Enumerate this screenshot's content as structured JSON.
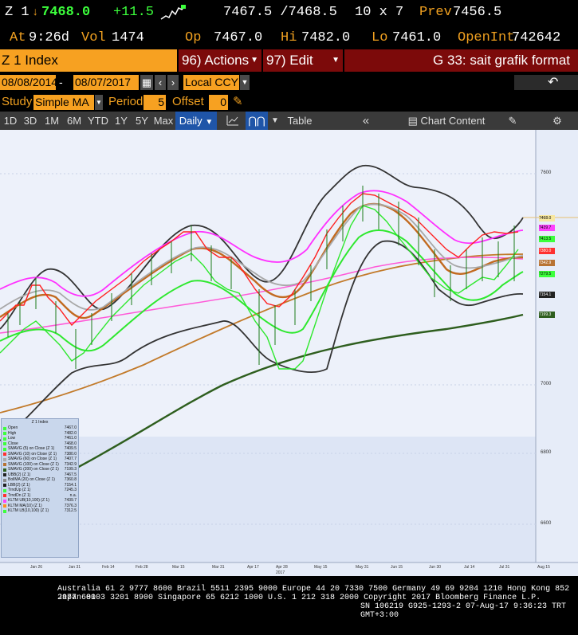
{
  "header": {
    "ticker": "Z 1",
    "last": "7468.0",
    "change": "+11.5",
    "bid_ask": "7467.5 /7468.5",
    "size": "10 x 7",
    "prev_label": "Prev",
    "prev": "7456.5",
    "at_label": "At",
    "time": "9:26d",
    "vol_label": "Vol",
    "vol": "1474",
    "op_label": "Op",
    "op": "7467.0",
    "hi_label": "Hi",
    "hi": "7482.0",
    "lo_label": "Lo",
    "lo": "7461.0",
    "oi_label": "OpenInt",
    "oi": "742642"
  },
  "commandbar": {
    "security": "Z 1 Index",
    "actions": "96) Actions",
    "edit": "97) Edit",
    "function": "G 33: sait grafik format"
  },
  "range": {
    "start": "08/08/2014",
    "dash": "-",
    "end": "08/07/2017",
    "currency": "Local CCY"
  },
  "study": {
    "label": "Study",
    "type": "Simple MA",
    "period_label": "Period",
    "period": "5",
    "offset_label": "Offset",
    "offset": "0"
  },
  "toolbar": {
    "periods": [
      "1D",
      "3D",
      "1M",
      "6M",
      "YTD",
      "1Y",
      "5Y",
      "Max"
    ],
    "frequency": "Daily",
    "table": "Table",
    "chart_content": "Chart Content"
  },
  "chart": {
    "yaxis": [
      "7600",
      "7000",
      "6800",
      "6600"
    ],
    "xaxis": [
      "Jan 26",
      "Jan 31",
      "Feb 14",
      "Feb 28",
      "Mar 15",
      "Mar 31",
      "Apr 17",
      "Apr 28",
      "May 15",
      "May 31",
      "Jun 15",
      "Jun 30",
      "Jul 14",
      "Jul 31",
      "Aug 15"
    ],
    "year": "2017",
    "right_tags": [
      {
        "v": "7468.0",
        "c": "#f7e7a0"
      },
      {
        "v": "7439.7",
        "c": "#ff40ff"
      },
      {
        "v": "7413.5",
        "c": "#3cff3c"
      },
      {
        "v": "7380.0",
        "c": "#ff3030"
      },
      {
        "v": "7342.9",
        "c": "#b87333"
      },
      {
        "v": "7279.5",
        "c": "#3cff3c"
      },
      {
        "v": "7154.1",
        "c": "#222222"
      },
      {
        "v": "7199.3",
        "c": "#2e5e1e"
      }
    ]
  },
  "legend": {
    "title": "Z 1 Index",
    "items": [
      {
        "label": "Open",
        "value": "7467.0",
        "color": "#3cff3c"
      },
      {
        "label": "High",
        "value": "7482.0",
        "color": "#3cff3c"
      },
      {
        "label": "Low",
        "value": "7461.0",
        "color": "#3cff3c"
      },
      {
        "label": "Close",
        "value": "7468.0",
        "color": "#3cff3c"
      },
      {
        "label": "SMAVG (5) on Close (Z 1)",
        "value": "7409.5",
        "color": "#3cff3c"
      },
      {
        "label": "SMAVG (10) on Close (Z 1)",
        "value": "7380.0",
        "color": "#ff3030"
      },
      {
        "label": "SMAVG (60) on Close (Z 1)",
        "value": "7407.7",
        "color": "#aaaaaa"
      },
      {
        "label": "SMAVG (100) on Close (Z 1)",
        "value": "7342.9",
        "color": "#b87333"
      },
      {
        "label": "SMAVG (200) on Close (Z 1)",
        "value": "7199.3",
        "color": "#2e5e1e"
      },
      {
        "label": "UBB(2) (Z 1)",
        "value": "7467.5",
        "color": "#222222"
      },
      {
        "label": "BollMA (20) on Close (Z 1)",
        "value": "7360.8",
        "color": "#888888"
      },
      {
        "label": "LBB(2) (Z 1)",
        "value": "7154.1",
        "color": "#222222"
      },
      {
        "label": "TrndUp (Z 1)",
        "value": "7245.3",
        "color": "#3cff3c"
      },
      {
        "label": "TrndDn (Z 1)",
        "value": "n.a.",
        "color": "#ff3030"
      },
      {
        "label": "KLTM UB(10,100) (Z 1)",
        "value": "7439.7",
        "color": "#ff40ff"
      },
      {
        "label": "KLTM MA(10) (Z 1)",
        "value": "7376.3",
        "color": "#ff9020"
      },
      {
        "label": "KLTM LB(10,100) (Z 1)",
        "value": "7312.5",
        "color": "#3cff3c"
      }
    ]
  },
  "footer": {
    "line1": "Australia 61 2 9777 8600 Brazil 5511 2395 9000 Europe 44 20 7330 7500 Germany 49 69 9204 1210 Hong Kong 852 2977 6000",
    "line2": "Japan 81 3 3201 8900        Singapore 65 6212 1000        U.S. 1 212 318 2000         Copyright 2017 Bloomberg Finance L.P.",
    "line3": "SN 106219 G925-1293-2 07-Aug-17  9:36:23 TRT  GMT+3:00"
  }
}
